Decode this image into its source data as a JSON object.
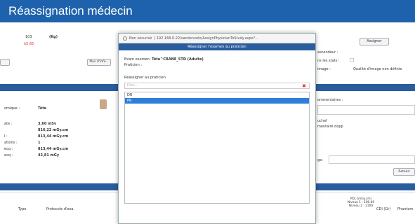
{
  "banner": {
    "title": "Réassignation médecin"
  },
  "browser": {
    "security": "Non sécurisé",
    "url": "192.168.0.22/sandenvelo/AssignPhysicianToStudy.aspx?..."
  },
  "modal": {
    "header": "Réassigner l'examen au praticien",
    "exam_label": "Exam examen:",
    "exam_value": "Tête^CRANE_STD (Adulte)",
    "praticien_label": "Praticien :",
    "assign_label": "Réassigner au praticien",
    "filter_placeholder": "Filtre...",
    "items": [
      "DR",
      "PR"
    ],
    "selected_index": 1
  },
  "background": {
    "left_top": {
      "v1": "103",
      "v2": "(Kg)",
      "v3": "$5.65"
    },
    "print_button": "Plus d'info...",
    "assign_button": "Assigner",
    "right_labels": [
      "ascendeur :",
      "ns les stats :",
      "image :"
    ],
    "quality": "Qualité d'image non définie",
    "left_panel": {
      "rows": [
        {
          "label": "omique :",
          "value": "Tête"
        },
        {
          "label": "ate :",
          "value": "3,60 mSv"
        },
        {
          "label": "",
          "value": "816,22 mGy.cm"
        },
        {
          "label": "l :",
          "value": "813,44 mGy.cm"
        },
        {
          "label": "ations :",
          "value": "1"
        },
        {
          "label": "ecq :",
          "value": "813,44 mGy.cm"
        },
        {
          "label": "ecq :",
          "value": "42,81 mGy"
        }
      ]
    },
    "right_panel": {
      "comments": "ommentaires :",
      "line1": "uchef",
      "line2": "mentaire dopp",
      "line3": "ge:",
      "btn": "Retoûri"
    },
    "table": {
      "headers": [
        "Type",
        "Protocole d'exa.",
        "PDL (mGy.cm) Niveau 1 : 100.00 Niveau 2 : 2100",
        "CDI (Gr)",
        "Phantom"
      ]
    }
  }
}
